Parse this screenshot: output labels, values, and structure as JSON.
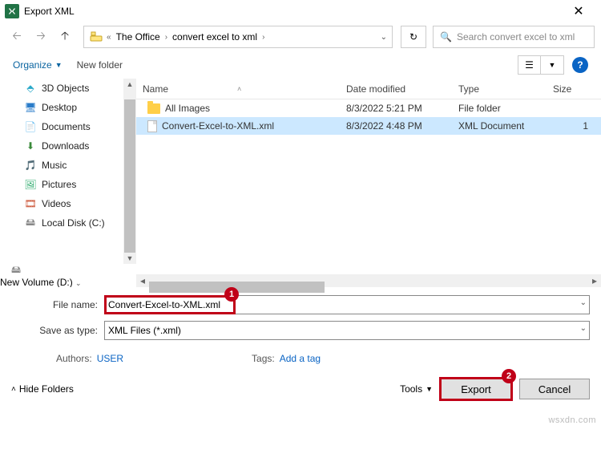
{
  "titlebar": {
    "title": "Export XML"
  },
  "breadcrumbs": {
    "a": "The Office",
    "b": "convert excel to xml"
  },
  "search": {
    "placeholder": "Search convert excel to xml"
  },
  "toolbar": {
    "organize": "Organize",
    "newfolder": "New folder"
  },
  "sidebar": {
    "items": [
      {
        "label": "3D Objects"
      },
      {
        "label": "Desktop"
      },
      {
        "label": "Documents"
      },
      {
        "label": "Downloads"
      },
      {
        "label": "Music"
      },
      {
        "label": "Pictures"
      },
      {
        "label": "Videos"
      },
      {
        "label": "Local Disk (C:)"
      }
    ],
    "last": "New Volume (D:)"
  },
  "cols": {
    "name": "Name",
    "date": "Date modified",
    "type": "Type",
    "size": "Size"
  },
  "files": [
    {
      "name": "All Images",
      "date": "8/3/2022 5:21 PM",
      "type": "File folder",
      "size": ""
    },
    {
      "name": "Convert-Excel-to-XML.xml",
      "date": "8/3/2022 4:48 PM",
      "type": "XML Document",
      "size": "1"
    }
  ],
  "input": {
    "filename_label": "File name:",
    "filename_value": "Convert-Excel-to-XML.xml",
    "savetype_label": "Save as type:",
    "savetype_value": "XML Files (*.xml)"
  },
  "meta": {
    "authors_k": "Authors:",
    "authors_v": "USER",
    "tags_k": "Tags:",
    "tags_v": "Add a tag"
  },
  "footer": {
    "hide": "Hide Folders",
    "tools": "Tools",
    "export": "Export",
    "cancel": "Cancel"
  },
  "callouts": {
    "one": "1",
    "two": "2"
  },
  "watermark": "wsxdn.com"
}
